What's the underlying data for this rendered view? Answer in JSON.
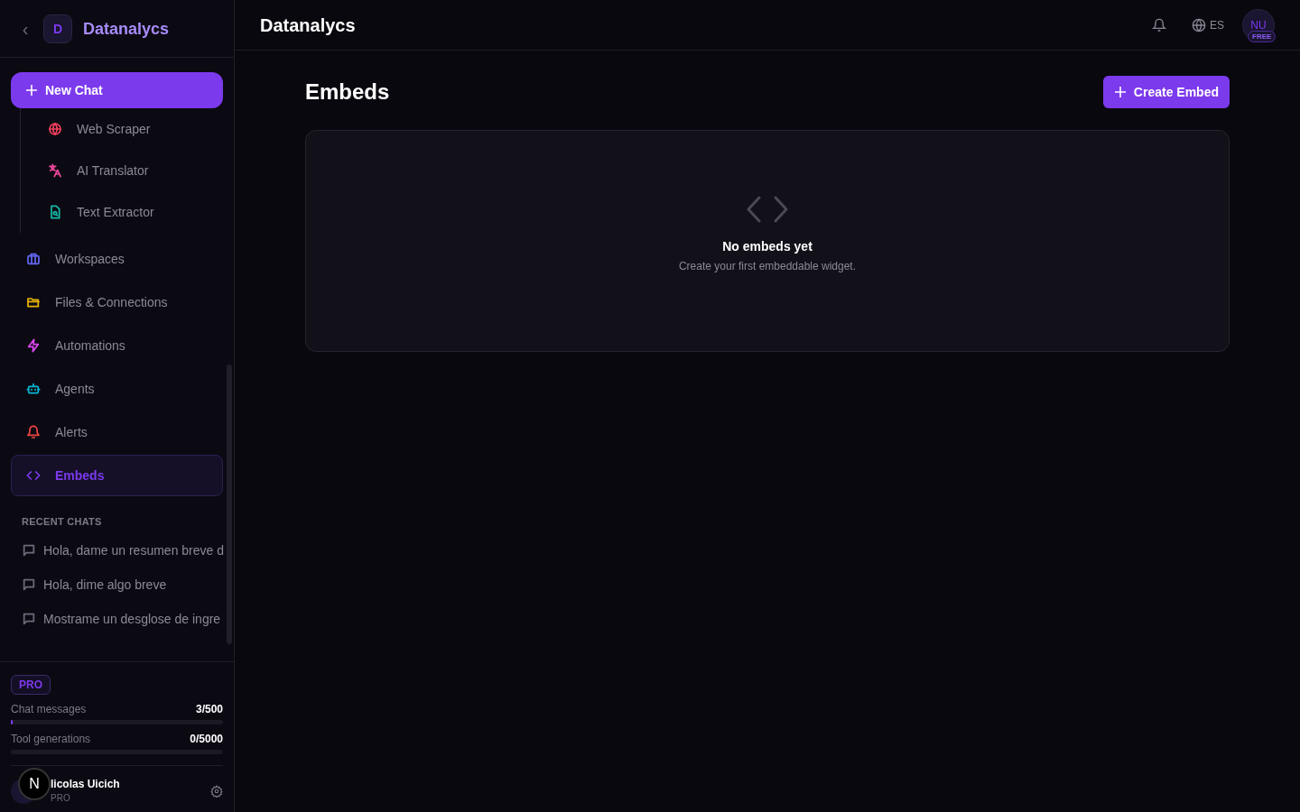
{
  "sidebar": {
    "back": "‹",
    "logo_letter": "D",
    "brand": "Datanalycs",
    "new_chat": "New Chat",
    "tools": [
      {
        "label": "Web Scraper",
        "color": "#f43f5e"
      },
      {
        "label": "AI Translator",
        "color": "#ec4899"
      },
      {
        "label": "Text Extractor",
        "color": "#14b8a6"
      }
    ],
    "nav": [
      {
        "label": "Workspaces",
        "color": "#6366f1",
        "selected": false
      },
      {
        "label": "Files & Connections",
        "color": "#eab308",
        "selected": false
      },
      {
        "label": "Automations",
        "color": "#d946ef",
        "selected": false
      },
      {
        "label": "Agents",
        "color": "#06b6d4",
        "selected": false
      },
      {
        "label": "Alerts",
        "color": "#ef4444",
        "selected": false
      },
      {
        "label": "Embeds",
        "color": "#7c3aed",
        "selected": true
      }
    ],
    "recent_heading": "RECENT CHATS",
    "recent_chats": [
      "Hola, dame un resumen breve d",
      "Hola, dime algo breve",
      "Mostrame un desglose de ingre"
    ],
    "plan_badge": "PRO",
    "usage": [
      {
        "label": "Chat messages",
        "value": "3/500",
        "level": 0.006
      },
      {
        "label": "Tool generations",
        "value": "0/5000",
        "level": 0
      }
    ],
    "user": {
      "name": "licolas Uicich",
      "plan": "PRO"
    },
    "dev_badge": "N"
  },
  "header": {
    "title": "Datanalycs",
    "language": "ES",
    "avatar": "NU",
    "avatar_badge": "FREE"
  },
  "main": {
    "title": "Embeds",
    "create_button": "Create Embed",
    "empty_title": "No embeds yet",
    "empty_text": "Create your first embeddable widget."
  }
}
